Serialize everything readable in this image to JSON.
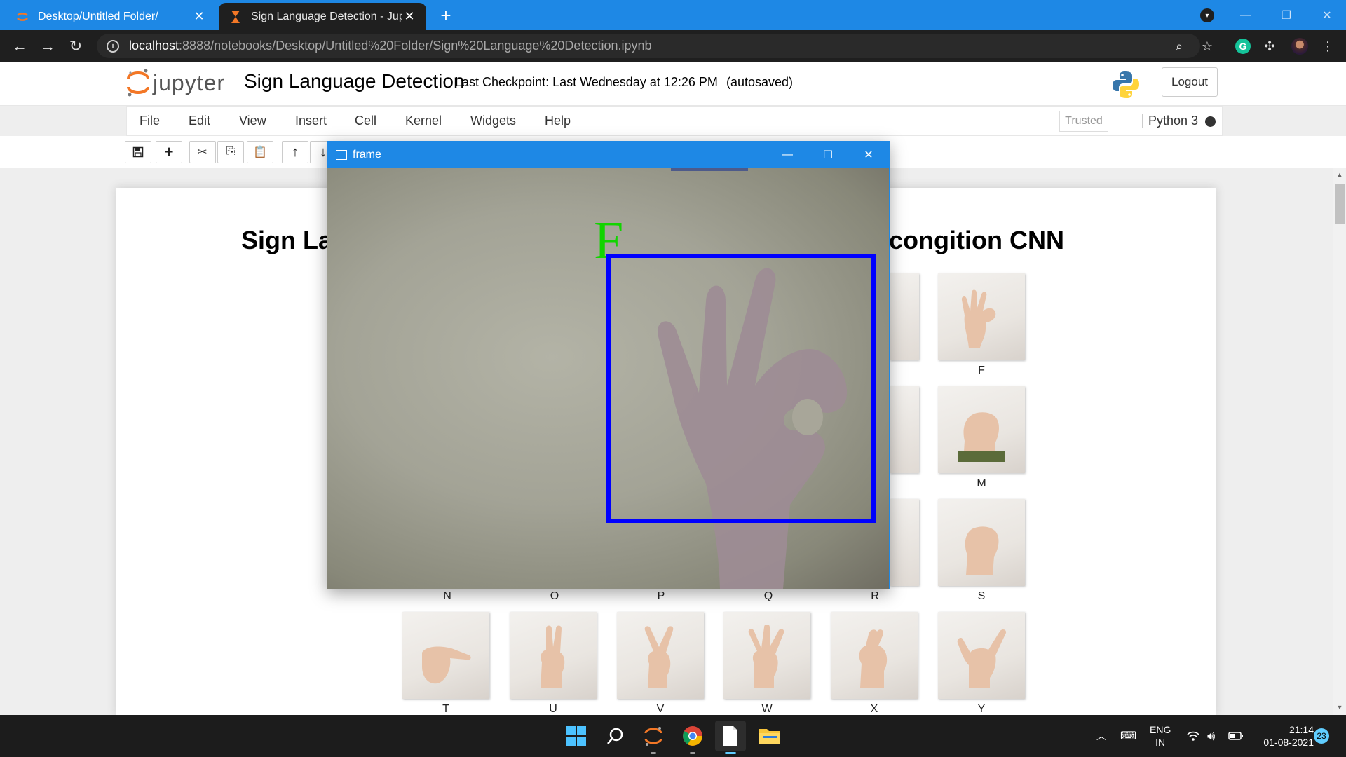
{
  "browser": {
    "tabs": [
      {
        "title": "Desktop/Untitled Folder/",
        "active": false
      },
      {
        "title": "Sign Language Detection - Jupyter",
        "active": true
      }
    ],
    "url_host": "localhost",
    "url_path": ":8888/notebooks/Desktop/Untitled%20Folder/Sign%20Language%20Detection.ipynb"
  },
  "jupyter": {
    "logo_text": "jupyter",
    "notebook_name": "Sign Language Detection",
    "checkpoint": "Last Checkpoint: Last Wednesday at 12:26 PM",
    "autosave": "(autosaved)",
    "logout": "Logout",
    "menu": [
      "File",
      "Edit",
      "View",
      "Insert",
      "Cell",
      "Kernel",
      "Widgets",
      "Help"
    ],
    "trusted": "Trusted",
    "kernel": "Python 3"
  },
  "notebook": {
    "title_left": "Sign La",
    "title_right": "congition CNN",
    "sign_labels": [
      "F",
      "M",
      "N",
      "O",
      "P",
      "Q",
      "R",
      "S",
      "T",
      "U",
      "V",
      "W",
      "X",
      "Y"
    ]
  },
  "frame_window": {
    "title": "frame",
    "prediction": "F",
    "roi_color": "#0000ff",
    "prediction_color": "#12d400"
  },
  "taskbar": {
    "lang_line1": "ENG",
    "lang_line2": "IN",
    "time": "21:14",
    "date": "01-08-2021",
    "notifications": "23"
  },
  "colors": {
    "accent": "#1e88e5",
    "jupyter_orange": "#f37726"
  }
}
